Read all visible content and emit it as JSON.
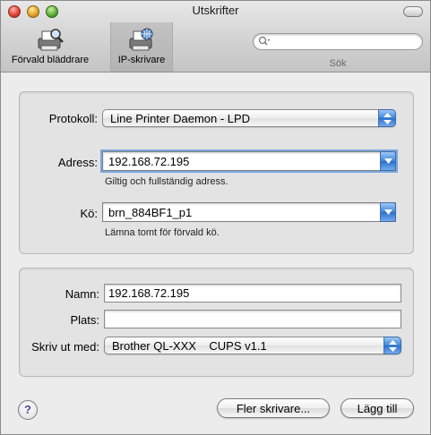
{
  "window": {
    "title": "Utskrifter"
  },
  "toolbar": {
    "default_browser_label": "Förvald bläddrare",
    "ip_printer_label": "IP-skrivare",
    "search": {
      "placeholder": "",
      "label": "Sök"
    }
  },
  "connection": {
    "protocol_label": "Protokoll:",
    "protocol_value": "Line Printer Daemon - LPD",
    "address_label": "Adress:",
    "address_value": "192.168.72.195",
    "address_hint": "Giltig och fullständig adress.",
    "queue_label": "Kö:",
    "queue_value": "brn_884BF1_p1",
    "queue_hint": "Lämna tomt för förvald kö."
  },
  "details": {
    "name_label": "Namn:",
    "name_value": "192.168.72.195",
    "location_label": "Plats:",
    "location_value": "",
    "print_with_label": "Skriv ut med:",
    "print_with_value": "Brother QL-XXX    CUPS v1.1"
  },
  "footer": {
    "help_label": "?",
    "more_printers_label": "Fler skrivare...",
    "add_label": "Lägg till"
  }
}
